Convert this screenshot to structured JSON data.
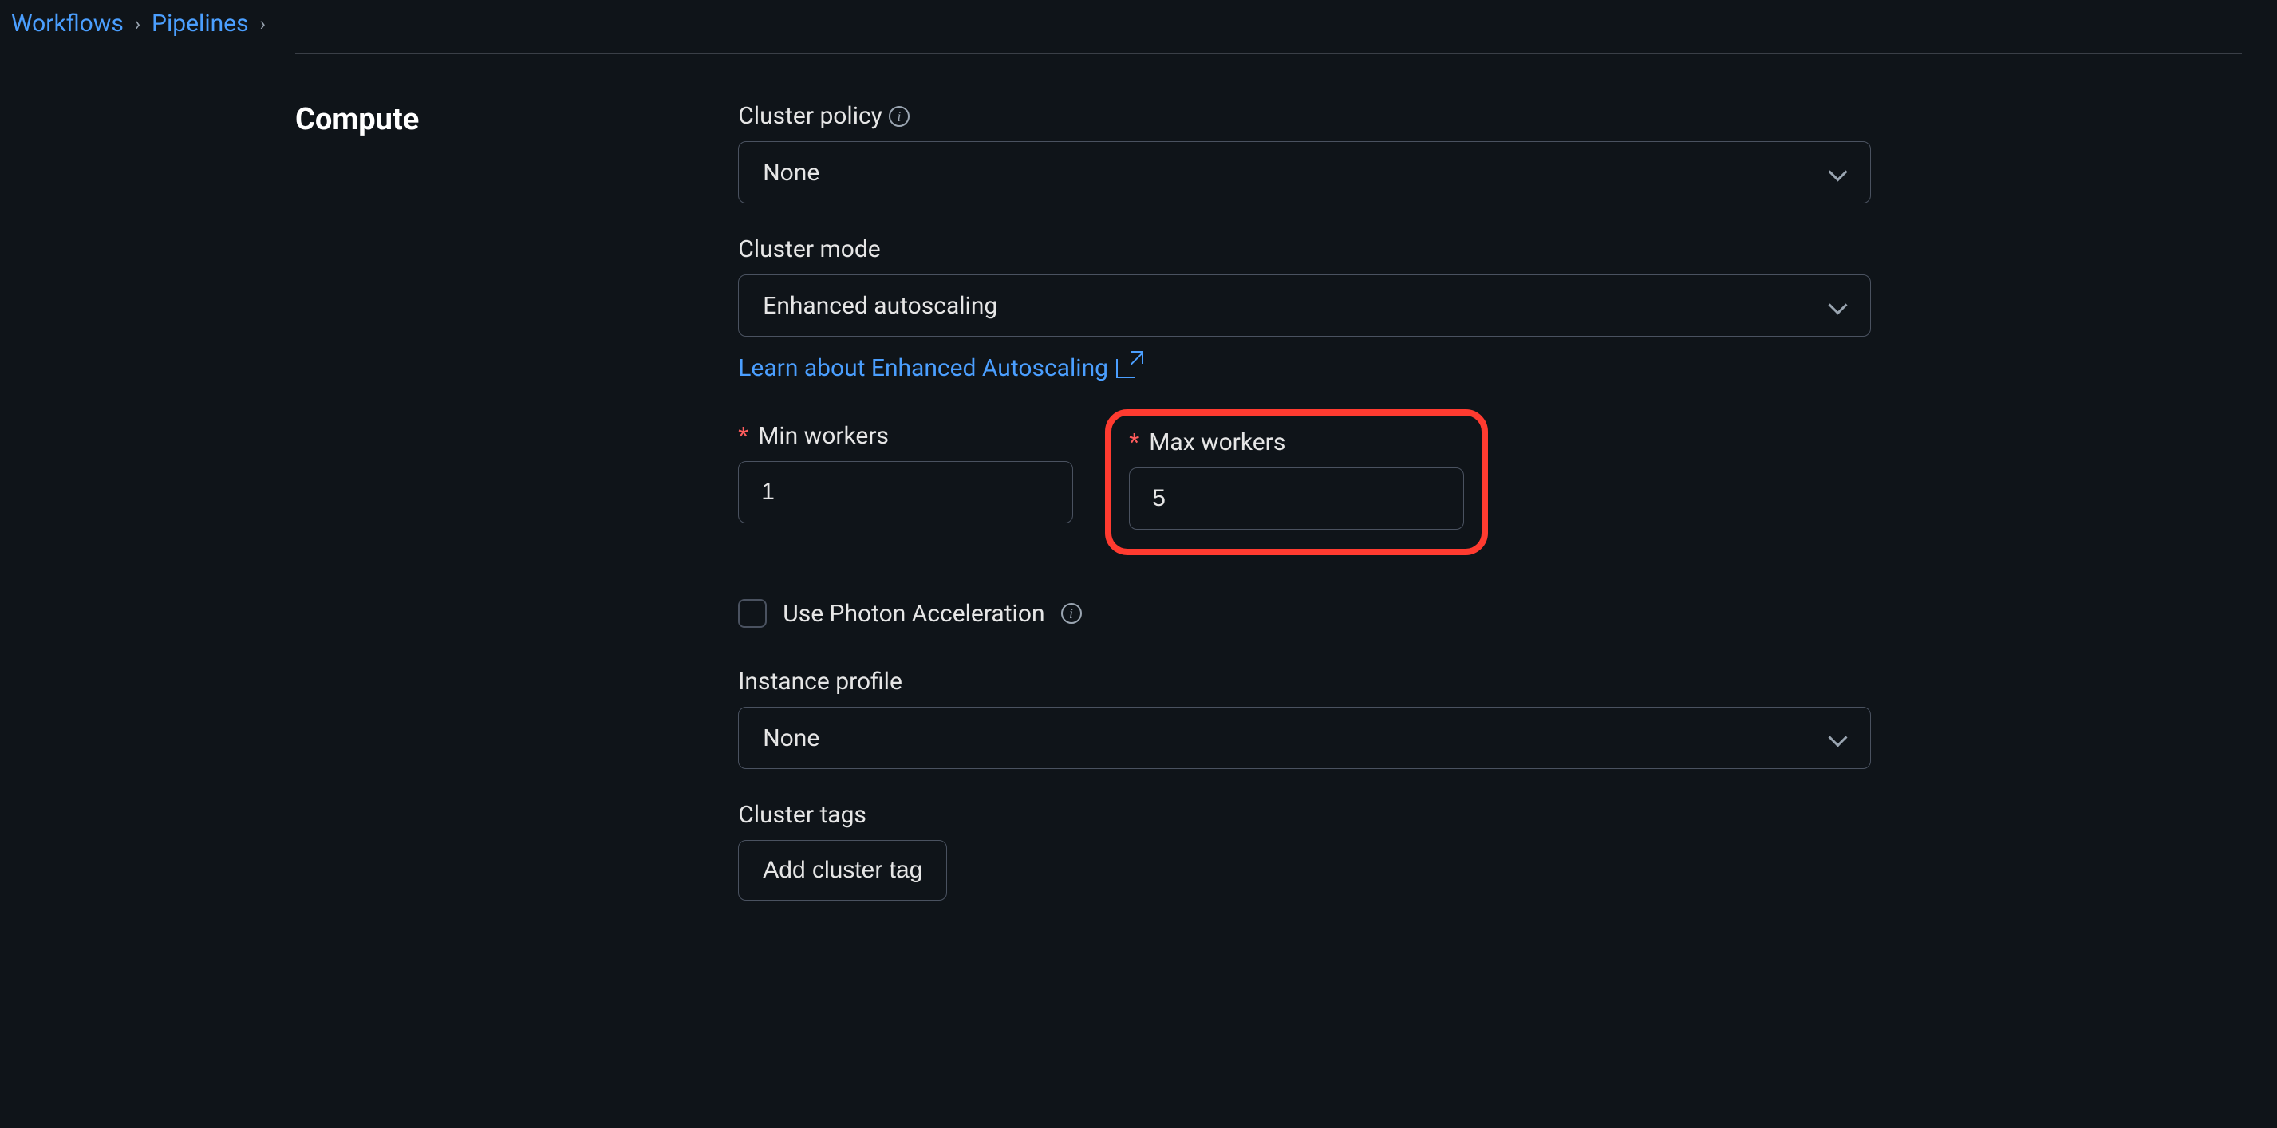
{
  "breadcrumb": {
    "items": [
      "Workflows",
      "Pipelines"
    ]
  },
  "section": {
    "title": "Compute"
  },
  "fields": {
    "cluster_policy": {
      "label": "Cluster policy",
      "value": "None"
    },
    "cluster_mode": {
      "label": "Cluster mode",
      "value": "Enhanced autoscaling",
      "learn_link": "Learn about Enhanced Autoscaling"
    },
    "min_workers": {
      "label": "Min workers",
      "value": "1"
    },
    "max_workers": {
      "label": "Max workers",
      "value": "5"
    },
    "photon": {
      "label": "Use Photon Acceleration"
    },
    "instance_profile": {
      "label": "Instance profile",
      "value": "None"
    },
    "cluster_tags": {
      "label": "Cluster tags",
      "button": "Add cluster tag"
    }
  }
}
